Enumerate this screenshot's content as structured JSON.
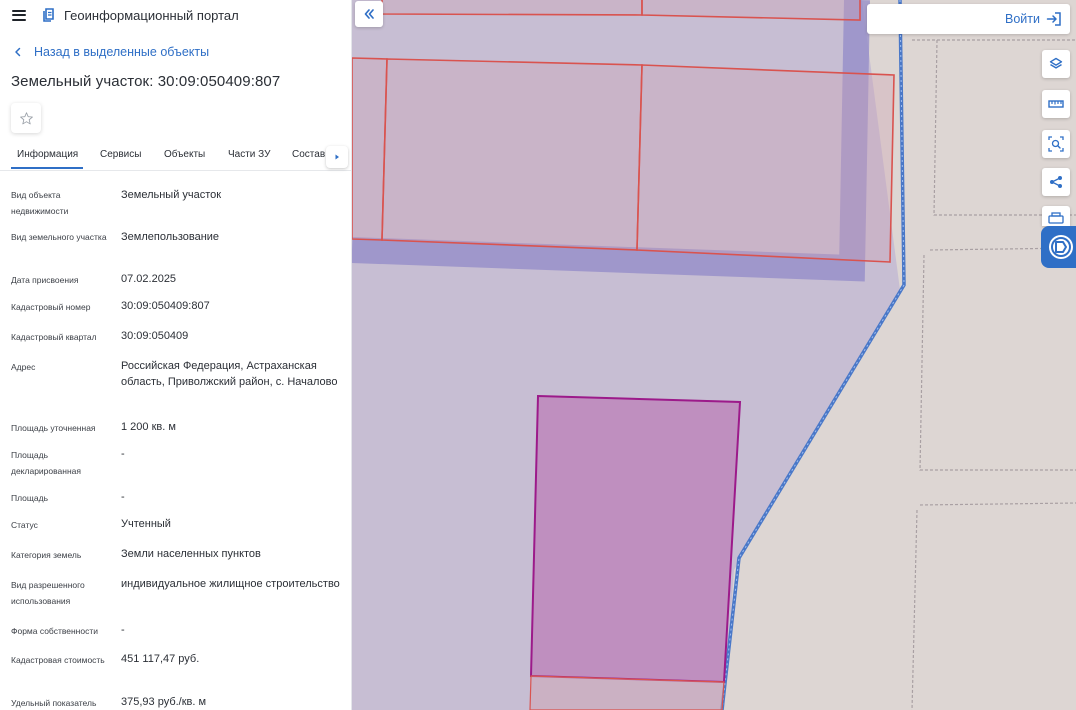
{
  "header": {
    "portal_title": "Геоинформационный портал"
  },
  "nav": {
    "back_label": "Назад в выделенные объекты"
  },
  "object": {
    "title": "Земельный участок: 30:09:050409:807"
  },
  "tabs": [
    {
      "label": "Информация",
      "active": true
    },
    {
      "label": "Сервисы",
      "active": false
    },
    {
      "label": "Объекты",
      "active": false
    },
    {
      "label": "Части ЗУ",
      "active": false
    },
    {
      "label": "Состав",
      "active": false
    }
  ],
  "details": [
    {
      "label": "Вид объекта недвижимости",
      "value": "Земельный участок"
    },
    {
      "label": "Вид земельного участка",
      "value": "Землепользование"
    },
    {
      "label": "Дата присвоения",
      "value": "07.02.2025"
    },
    {
      "label": "Кадастровый номер",
      "value": "30:09:050409:807"
    },
    {
      "label": "Кадастровый квартал",
      "value": "30:09:050409"
    },
    {
      "label": "Адрес",
      "value": "Российская Федерация, Астраханская область, Приволжский район, с. Началово"
    },
    {
      "label": "Площадь уточненная",
      "value": "1 200 кв. м"
    },
    {
      "label": "Площадь декларированная",
      "value": "-"
    },
    {
      "label": "Площадь",
      "value": "-"
    },
    {
      "label": "Статус",
      "value": "Учтенный"
    },
    {
      "label": "Категория земель",
      "value": "Земли населенных пунктов"
    },
    {
      "label": "Вид разрешенного использования",
      "value": "индивидуальное жилищное строительство"
    },
    {
      "label": "Форма собственности",
      "value": "-"
    },
    {
      "label": "Кадастровая стоимость",
      "value": "451 117,47 руб."
    },
    {
      "label": "Удельный показатель",
      "value": "375,93 руб./кв. м"
    }
  ],
  "map": {
    "login_label": "Войти"
  },
  "icons": {
    "menu": "menu-icon",
    "logo": "portal-logo-icon",
    "back": "chevron-left-icon",
    "favorite": "star-icon",
    "tabs_next": "triangle-right-icon",
    "collapse": "double-chevron-left-icon",
    "login": "sign-in-icon",
    "layers": "layers-icon",
    "measure": "ruler-icon",
    "select_area": "area-search-icon",
    "share": "share-icon",
    "print": "print-icon",
    "widget": "widget-icon"
  },
  "colors": {
    "accent": "#2f6fc6",
    "selected_parcel_fill": "#bf8fbf",
    "selected_parcel_border": "#9c1a8a",
    "parcel_border": "#d9534f",
    "quarter_boundary": "#4a78c8",
    "map_background": "#c7bed3",
    "outside_area": "#ddd6d3"
  }
}
